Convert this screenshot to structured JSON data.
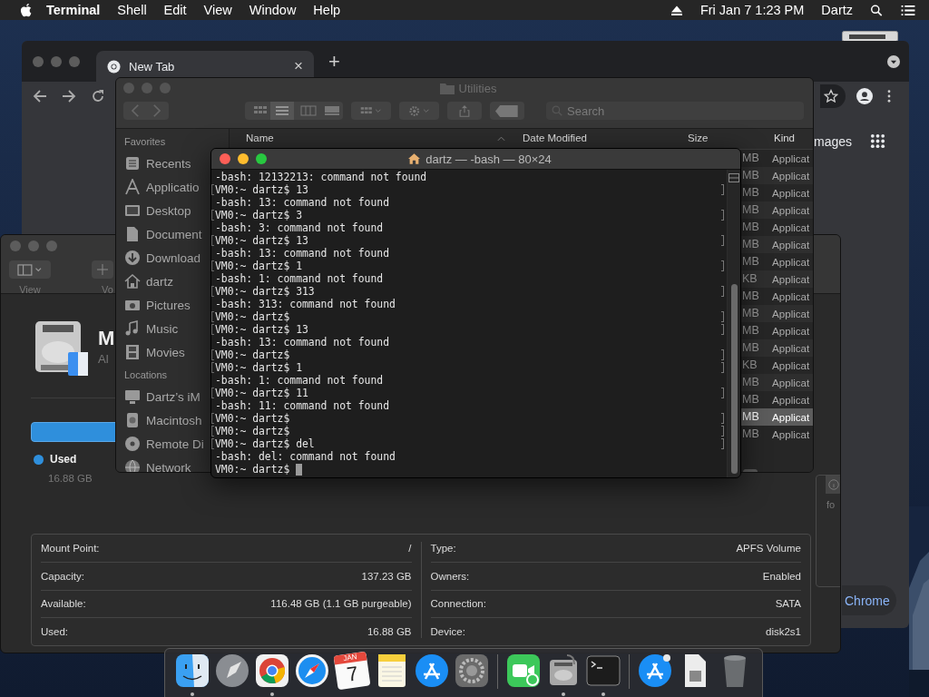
{
  "menu_bar": {
    "app": "Terminal",
    "menus": [
      "Shell",
      "Edit",
      "View",
      "Window",
      "Help"
    ],
    "clock": "Fri Jan 7  1:23 PM",
    "user": "Dartz"
  },
  "chrome": {
    "tab": "New Tab",
    "tab_close": "×",
    "new_tab": "+",
    "images_link": "mages",
    "customize_button": "Chrome"
  },
  "disk_utility": {
    "toolbar": [
      {
        "label": "View",
        "kind": "view"
      },
      {
        "label": "Vo",
        "kind": "add"
      },
      {
        "label": "fo",
        "kind": "info"
      }
    ],
    "volume_name": "M",
    "volume_subtitle": "Al",
    "legend": {
      "label": "Used",
      "value": "16.88 GB",
      "color": "#2f8fdc"
    },
    "info_left": [
      {
        "label": "Mount Point:",
        "value": "/"
      },
      {
        "label": "Capacity:",
        "value": "137.23 GB"
      },
      {
        "label": "Available:",
        "value": "116.48 GB (1.1 GB purgeable)"
      },
      {
        "label": "Used:",
        "value": "16.88 GB"
      }
    ],
    "info_right": [
      {
        "label": "Type:",
        "value": "APFS Volume"
      },
      {
        "label": "Owners:",
        "value": "Enabled"
      },
      {
        "label": "Connection:",
        "value": "SATA"
      },
      {
        "label": "Device:",
        "value": "disk2s1"
      }
    ]
  },
  "finder": {
    "title": "Utilities",
    "search_placeholder": "Search",
    "sidebar": [
      {
        "heading": "Favorites",
        "items": [
          {
            "label": "Recents",
            "kind": "recents"
          },
          {
            "label": "Applicatio",
            "kind": "apps"
          },
          {
            "label": "Desktop",
            "kind": "desktop"
          },
          {
            "label": "Document",
            "kind": "documents"
          },
          {
            "label": "Download",
            "kind": "downloads"
          },
          {
            "label": "dartz",
            "kind": "home"
          },
          {
            "label": "Pictures",
            "kind": "pictures"
          },
          {
            "label": "Music",
            "kind": "music"
          },
          {
            "label": "Movies",
            "kind": "movies"
          }
        ]
      },
      {
        "heading": "Locations",
        "items": [
          {
            "label": "Dartz’s iM",
            "kind": "computer"
          },
          {
            "label": "Macintosh",
            "kind": "disk"
          },
          {
            "label": "Remote Di",
            "kind": "disc"
          },
          {
            "label": "Network",
            "kind": "network"
          }
        ]
      }
    ],
    "columns": [
      "Name",
      "Date Modified",
      "Size",
      "Kind"
    ],
    "rows": [
      {
        "size": "MB",
        "kind": "Applicat",
        "selected": false
      },
      {
        "size": "MB",
        "kind": "Applicat",
        "selected": false
      },
      {
        "size": "MB",
        "kind": "Applicat",
        "selected": false
      },
      {
        "size": "MB",
        "kind": "Applicat",
        "selected": false
      },
      {
        "size": "MB",
        "kind": "Applicat",
        "selected": false
      },
      {
        "size": "MB",
        "kind": "Applicat",
        "selected": false
      },
      {
        "size": "MB",
        "kind": "Applicat",
        "selected": false
      },
      {
        "size": "KB",
        "kind": "Applicat",
        "selected": false
      },
      {
        "size": "MB",
        "kind": "Applicat",
        "selected": false
      },
      {
        "size": "MB",
        "kind": "Applicat",
        "selected": false
      },
      {
        "size": "MB",
        "kind": "Applicat",
        "selected": false
      },
      {
        "size": "MB",
        "kind": "Applicat",
        "selected": false
      },
      {
        "size": "KB",
        "kind": "Applicat",
        "selected": false
      },
      {
        "size": "MB",
        "kind": "Applicat",
        "selected": false
      },
      {
        "size": "MB",
        "kind": "Applicat",
        "selected": false
      },
      {
        "size": "MB",
        "kind": "Applicat",
        "selected": true
      },
      {
        "size": "MB",
        "kind": "Applicat",
        "selected": false
      }
    ]
  },
  "terminal": {
    "title": "dartz — -bash — 80×24",
    "cursor_visible": true,
    "lines": [
      {
        "text": "-bash: 12132213: command not found",
        "marked": false
      },
      {
        "text": "VM0:~ dartz$ 13",
        "marked": true
      },
      {
        "text": "-bash: 13: command not found",
        "marked": false
      },
      {
        "text": "VM0:~ dartz$ 3",
        "marked": true
      },
      {
        "text": "-bash: 3: command not found",
        "marked": false
      },
      {
        "text": "VM0:~ dartz$ 13",
        "marked": true
      },
      {
        "text": "-bash: 13: command not found",
        "marked": false
      },
      {
        "text": "VM0:~ dartz$ 1",
        "marked": true
      },
      {
        "text": "-bash: 1: command not found",
        "marked": false
      },
      {
        "text": "VM0:~ dartz$ 313",
        "marked": true
      },
      {
        "text": "-bash: 313: command not found",
        "marked": false
      },
      {
        "text": "VM0:~ dartz$",
        "marked": true
      },
      {
        "text": "VM0:~ dartz$ 13",
        "marked": true
      },
      {
        "text": "-bash: 13: command not found",
        "marked": false
      },
      {
        "text": "VM0:~ dartz$",
        "marked": true
      },
      {
        "text": "VM0:~ dartz$ 1",
        "marked": true
      },
      {
        "text": "-bash: 1: command not found",
        "marked": false
      },
      {
        "text": "VM0:~ dartz$ 11",
        "marked": true
      },
      {
        "text": "-bash: 11: command not found",
        "marked": false
      },
      {
        "text": "VM0:~ dartz$",
        "marked": true
      },
      {
        "text": "VM0:~ dartz$",
        "marked": true
      },
      {
        "text": "VM0:~ dartz$ del",
        "marked": true
      },
      {
        "text": "-bash: del: command not found",
        "marked": false
      },
      {
        "text": "VM0:~ dartz$",
        "marked": false
      }
    ]
  },
  "dock": {
    "items": [
      {
        "kind": "finder",
        "running": true
      },
      {
        "kind": "launchpad",
        "running": false
      },
      {
        "kind": "chrome",
        "running": true
      },
      {
        "kind": "safari",
        "running": false
      },
      {
        "kind": "calendar",
        "running": false,
        "month": "JAN",
        "day": "7"
      },
      {
        "kind": "notes",
        "running": false
      },
      {
        "kind": "appstore",
        "running": false
      },
      {
        "kind": "preferences",
        "running": false
      },
      {
        "kind": "separator"
      },
      {
        "kind": "facetime",
        "running": false
      },
      {
        "kind": "diskutility",
        "running": true
      },
      {
        "kind": "terminal",
        "running": true
      },
      {
        "kind": "separator"
      },
      {
        "kind": "downloads",
        "running": false
      },
      {
        "kind": "document",
        "running": false
      },
      {
        "kind": "trash",
        "running": false
      }
    ]
  }
}
